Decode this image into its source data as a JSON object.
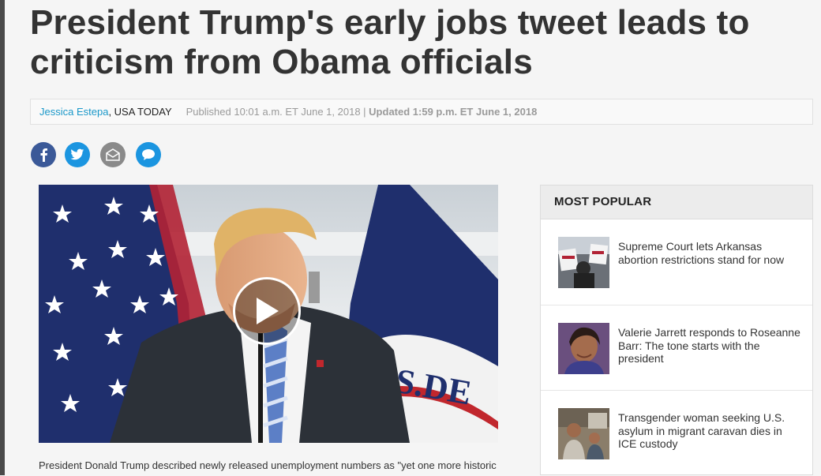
{
  "article": {
    "headline": "President Trump's early jobs tweet leads to criticism from Obama officials",
    "author": "Jessica Estepa",
    "org": ", USA TODAY",
    "published": "Published 10:01 a.m. ET June 1, 2018",
    "separator": " | ",
    "updated": "Updated 1:59 p.m. ET June 1, 2018",
    "caption": "President Donald Trump described newly released unemployment numbers as \"yet one more historic"
  },
  "share": {
    "facebook_icon": "facebook-icon",
    "twitter_icon": "twitter-icon",
    "email_icon": "email-icon",
    "comment_icon": "comment-icon"
  },
  "video": {
    "play_icon": "play-icon"
  },
  "most_popular": {
    "header": "MOST POPULAR",
    "items": [
      {
        "title": "Supreme Court lets Arkansas abortion restrictions stand for now"
      },
      {
        "title": "Valerie Jarrett responds to Roseanne Barr: The tone starts with the president"
      },
      {
        "title": "Transgender woman seeking U.S. asylum in migrant caravan dies in ICE custody"
      }
    ]
  },
  "colors": {
    "author_link": "#1a98c9",
    "facebook": "#3b5998",
    "twitter": "#1b95e0",
    "email": "#8a8a8a"
  }
}
